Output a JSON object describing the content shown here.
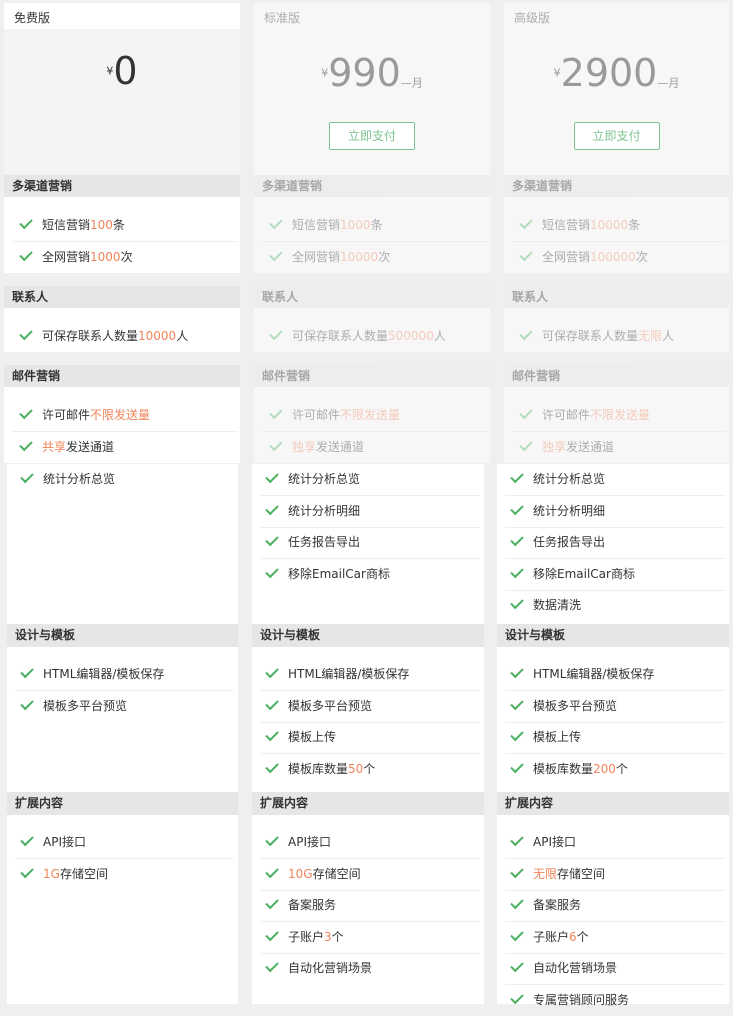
{
  "plans": [
    {
      "name": "免费版",
      "currency": "¥",
      "price": "0",
      "unit": ""
    },
    {
      "name": "标准版",
      "currency": "¥",
      "price": "990",
      "unit": "—月",
      "pay_label": "立即支付"
    },
    {
      "name": "高级版",
      "currency": "¥",
      "price": "2900",
      "unit": "—月",
      "pay_label": "立即支付"
    }
  ],
  "categories": {
    "multichannel": "多渠道营销",
    "contacts": "联系人",
    "email": "邮件营销",
    "design": "设计与模板",
    "extension": "扩展内容"
  },
  "free": {
    "multichannel": [
      [
        "短信营销",
        "100",
        "条"
      ],
      [
        "全网营销",
        "1000",
        "次"
      ]
    ],
    "contacts": [
      [
        "可保存联系人数量",
        "10000",
        "人"
      ]
    ],
    "email": [
      [
        "许可邮件",
        "不限发送量",
        ""
      ],
      [
        "",
        "共享",
        "发送通道"
      ]
    ],
    "analytics": [
      [
        "统计分析总览",
        "",
        ""
      ]
    ],
    "design": [
      [
        "HTML编辑器/模板保存",
        "",
        ""
      ],
      [
        "模板多平台预览",
        "",
        ""
      ]
    ],
    "extension": [
      [
        "API接口",
        "",
        ""
      ],
      [
        "",
        "1G",
        "存储空间"
      ]
    ]
  },
  "standard": {
    "multichannel": [
      [
        "短信营销",
        "1000",
        "条"
      ],
      [
        "全网营销",
        "10000",
        "次"
      ]
    ],
    "contacts": [
      [
        "可保存联系人数量",
        "500000",
        "人"
      ]
    ],
    "email": [
      [
        "许可邮件",
        "不限发送量",
        ""
      ],
      [
        "",
        "独享",
        "发送通道"
      ]
    ],
    "analytics": [
      [
        "统计分析总览",
        "",
        ""
      ],
      [
        "统计分析明细",
        "",
        ""
      ],
      [
        "任务报告导出",
        "",
        ""
      ],
      [
        "移除EmailCar商标",
        "",
        ""
      ]
    ],
    "design": [
      [
        "HTML编辑器/模板保存",
        "",
        ""
      ],
      [
        "模板多平台预览",
        "",
        ""
      ],
      [
        "模板上传",
        "",
        ""
      ],
      [
        "模板库数量",
        "50",
        "个"
      ]
    ],
    "extension": [
      [
        "API接口",
        "",
        ""
      ],
      [
        "",
        "10G",
        "存储空间"
      ],
      [
        "备案服务",
        "",
        ""
      ],
      [
        "子账户",
        "3",
        "个"
      ],
      [
        "自动化营销场景",
        "",
        ""
      ]
    ]
  },
  "premium": {
    "multichannel": [
      [
        "短信营销",
        "10000",
        "条"
      ],
      [
        "全网营销",
        "100000",
        "次"
      ]
    ],
    "contacts": [
      [
        "可保存联系人数量",
        "无限",
        "人"
      ]
    ],
    "email": [
      [
        "许可邮件",
        "不限发送量",
        ""
      ],
      [
        "",
        "独享",
        "发送通道"
      ]
    ],
    "analytics": [
      [
        "统计分析总览",
        "",
        ""
      ],
      [
        "统计分析明细",
        "",
        ""
      ],
      [
        "任务报告导出",
        "",
        ""
      ],
      [
        "移除EmailCar商标",
        "",
        ""
      ],
      [
        "数据清洗",
        "",
        ""
      ]
    ],
    "design": [
      [
        "HTML编辑器/模板保存",
        "",
        ""
      ],
      [
        "模板多平台预览",
        "",
        ""
      ],
      [
        "模板上传",
        "",
        ""
      ],
      [
        "模板库数量",
        "200",
        "个"
      ]
    ],
    "extension": [
      [
        "API接口",
        "",
        ""
      ],
      [
        "",
        "无限",
        "存储空间"
      ],
      [
        "备案服务",
        "",
        ""
      ],
      [
        "子账户",
        "6",
        "个"
      ],
      [
        "自动化营销场景",
        "",
        ""
      ],
      [
        "专属营销顾问服务",
        "",
        ""
      ]
    ]
  },
  "colors": {
    "check": "#4ab05f",
    "highlight": "#f0845a",
    "button": "#7fc491"
  }
}
